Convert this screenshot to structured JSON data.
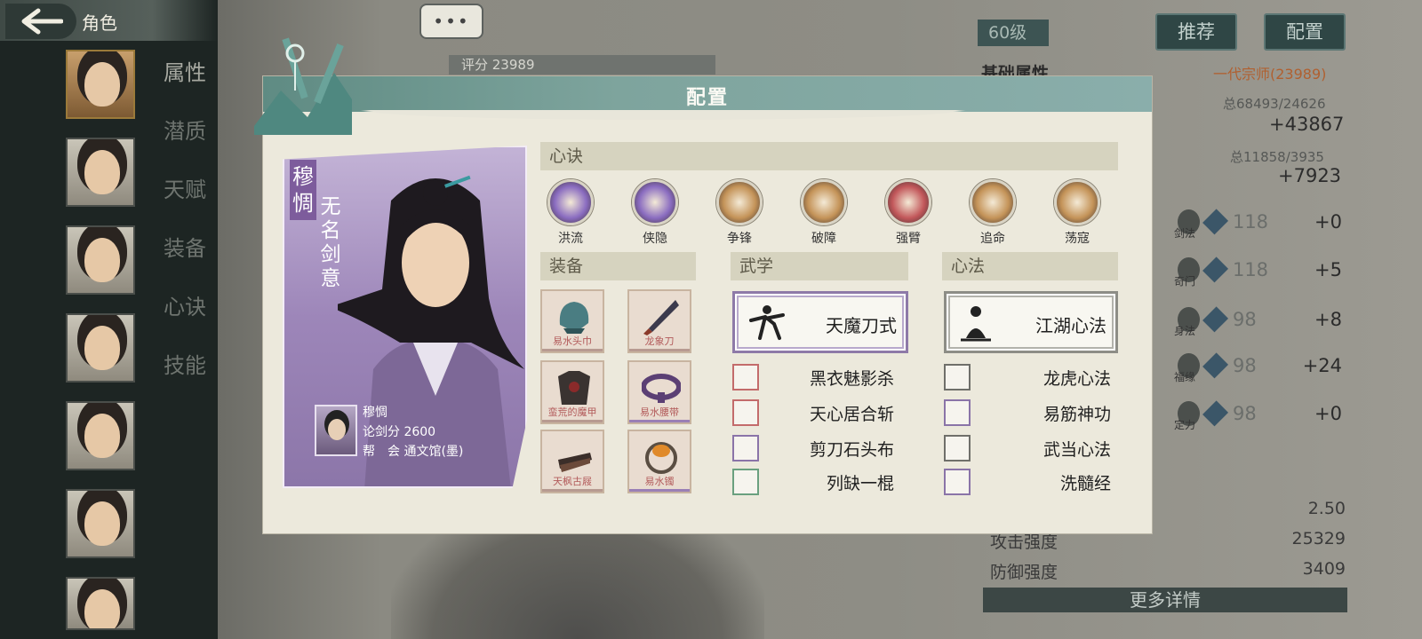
{
  "header": {
    "title": "角色"
  },
  "chat": {
    "label": "•••"
  },
  "side_menu": [
    "属性",
    "潜质",
    "天赋",
    "装备",
    "心诀",
    "技能"
  ],
  "score_bar": {
    "text": "评分 23989"
  },
  "stats_panel": {
    "level": "60级",
    "btn_recommend": "推荐",
    "btn_config": "配置",
    "section_title": "基础属性",
    "rank_title": "一代宗师(23989)",
    "total1": "总68493/24626",
    "bonus1": "+43867",
    "total2": "总11858/3935",
    "bonus2": "+7923",
    "skills": [
      {
        "name": "剑法",
        "value": "118",
        "plus": "+0"
      },
      {
        "name": "奇门",
        "value": "118",
        "plus": "+5"
      },
      {
        "name": "身法",
        "value": "98",
        "plus": "+8"
      },
      {
        "name": "福缘",
        "value": "98",
        "plus": "+24"
      },
      {
        "name": "定力",
        "value": "98",
        "plus": "+0"
      }
    ],
    "extra_value": "2.50",
    "attack_label": "攻击强度",
    "attack_value": "25329",
    "defense_label": "防御强度",
    "defense_value": "3409",
    "more_detail": "更多详情"
  },
  "modal": {
    "title": "配置",
    "card": {
      "name": "穆惆",
      "title": "无名剑意",
      "mini_name": "穆惆",
      "score": "论剑分 2600",
      "guild": "帮　会 通文馆(墨)"
    },
    "xinjue_header": "心诀",
    "xinjue": [
      {
        "label": "洪流",
        "color": "#8a6cc0"
      },
      {
        "label": "侠隐",
        "color": "#8a6cc0"
      },
      {
        "label": "争锋",
        "color": "#c49358"
      },
      {
        "label": "破障",
        "color": "#c49358"
      },
      {
        "label": "强臂",
        "color": "#c2575a"
      },
      {
        "label": "追命",
        "color": "#c49358"
      },
      {
        "label": "荡寇",
        "color": "#c49358"
      }
    ],
    "equip_header": "装备",
    "equipment": [
      {
        "name": "易水头巾",
        "icon": "headscarf-icon"
      },
      {
        "name": "龙象刀",
        "icon": "blade-icon"
      },
      {
        "name": "蛮荒的魔甲",
        "icon": "armor-icon"
      },
      {
        "name": "易水腰带",
        "icon": "belt-icon"
      },
      {
        "name": "天枫古屐",
        "icon": "shoes-icon"
      },
      {
        "name": "易水镯",
        "icon": "bracelet-icon"
      }
    ],
    "wuxue_header": "武学",
    "wuxue_main": "天魔刀式",
    "wuxue_list": [
      "黑衣魅影杀",
      "天心居合斩",
      "剪刀石头布",
      "列缺一棍"
    ],
    "xinfa_header": "心法",
    "xinfa_main": "江湖心法",
    "xinfa_list": [
      "龙虎心法",
      "易筋神功",
      "武当心法",
      "洗髓经"
    ]
  }
}
